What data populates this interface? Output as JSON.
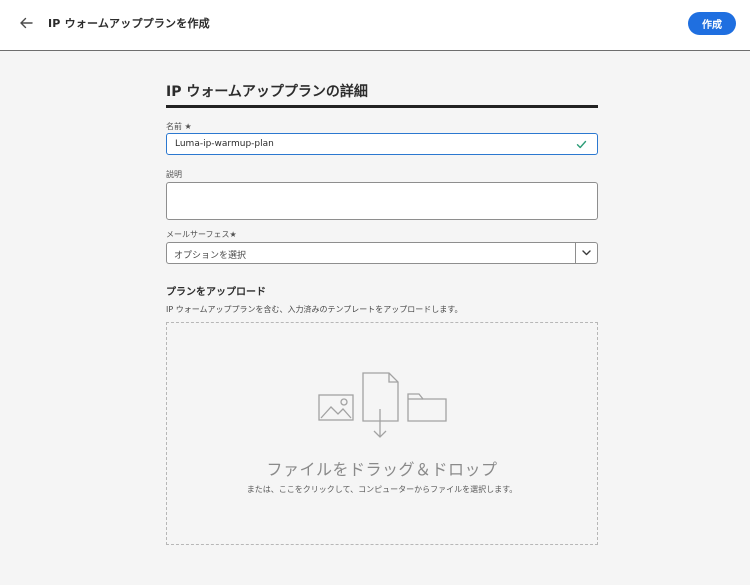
{
  "header": {
    "title": "IP ウォームアッププランを作成",
    "create_label": "作成"
  },
  "details": {
    "section_title": "IP ウォームアッププランの詳細",
    "name_label": "名前 ★",
    "name_value": "Luma-ip-warmup-plan",
    "description_label": "説明",
    "description_value": "",
    "surface_label": "メールサーフェス★",
    "surface_placeholder": "オプションを選択"
  },
  "upload": {
    "title": "プランをアップロード",
    "description": "IP ウォームアッププランを含む、入力済みのテンプレートをアップロードします。",
    "drop_title": "ファイルをドラッグ＆ドロップ",
    "drop_subtitle": "または、ここをクリックして、コンピューターからファイルを選択します。"
  },
  "colors": {
    "accent": "#1f6fe0",
    "valid": "#2d9d78",
    "background": "#f5f5f5"
  },
  "icons": [
    "back-arrow-icon",
    "checkmark-icon",
    "chevron-down-icon",
    "image-icon",
    "file-icon",
    "folder-icon",
    "download-arrow-icon"
  ]
}
